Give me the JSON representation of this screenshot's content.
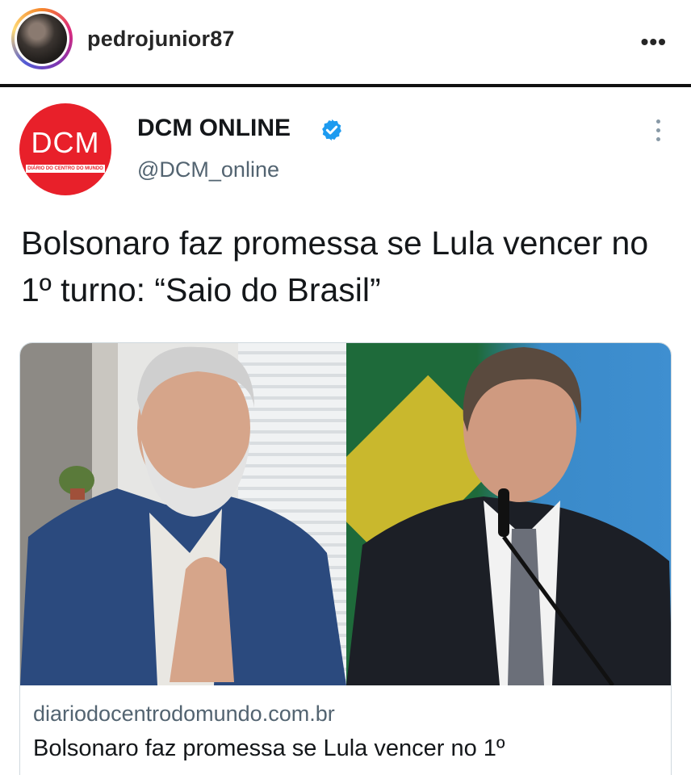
{
  "instagram": {
    "username": "pedrojunior87",
    "more_icon": "more-horizontal-icon"
  },
  "tweet": {
    "author_name": "DCM ONLINE",
    "author_handle": "@DCM_online",
    "verified": true,
    "logo_text": "DCM",
    "logo_subtext": "DIÁRIO DO CENTRO DO MUNDO",
    "text": "Bolsonaro faz promessa se Lula vencer no 1º turno: “Saio do Brasil”",
    "more_icon": "more-vertical-icon",
    "brand_color": "#e8202a",
    "verified_color": "#1d9bf0"
  },
  "link_card": {
    "domain": "diariodocentrodomundo.com.br",
    "title": "Bolsonaro faz promessa se Lula vencer no 1º"
  }
}
